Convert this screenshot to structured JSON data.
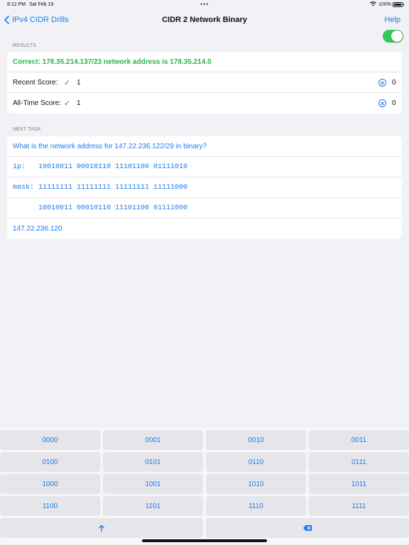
{
  "status": {
    "time": "8:12 PM",
    "date": "Sat Feb 19",
    "battery": "100%"
  },
  "nav": {
    "back_label": "IPv4 CIDR Drills",
    "title": "CIDR 2 Network Binary",
    "help_label": "Help"
  },
  "toggle": {
    "on": true,
    "color": "#34c759"
  },
  "results": {
    "header": "RESULTS",
    "message": "Correct: 178.35.214.137/23 network address is 178.35.214.0",
    "recent": {
      "label": "Recent Score:",
      "check": "✓",
      "value": "1",
      "right_value": "0"
    },
    "alltime": {
      "label": "All-Time Score:",
      "check": "✓",
      "value": "1",
      "right_value": "0"
    }
  },
  "task": {
    "header": "NEXT TASK",
    "question": "What is the network address for  147.22.236.122/29 in binary?",
    "ip_line": "ip:   10010011 00010110 11101100 01111010",
    "mask_line": "mask: 11111111 11111111 11111111 11111000",
    "result_line": "      10010011 00010110 11101100 01111000",
    "answer": "147.22.236.120"
  },
  "keyboard": {
    "keys": [
      "0000",
      "0001",
      "0010",
      "0011",
      "0100",
      "0101",
      "0110",
      "0111",
      "1000",
      "1001",
      "1010",
      "1011",
      "1100",
      "1101",
      "1110",
      "1111"
    ],
    "shift_icon": "up-arrow-icon",
    "delete_icon": "backspace-icon"
  },
  "colors": {
    "accent": "#1a7cf0",
    "success": "#2ab34a",
    "background": "#f1f1f6"
  }
}
